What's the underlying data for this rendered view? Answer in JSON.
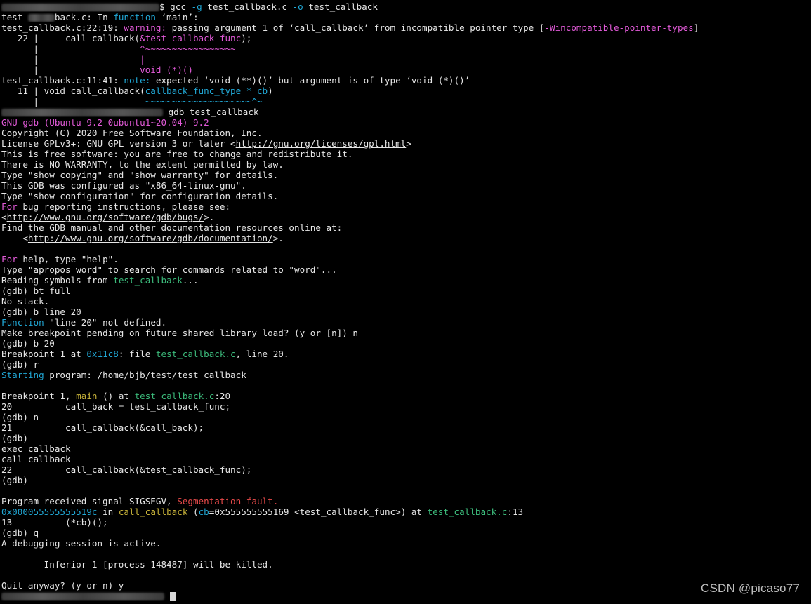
{
  "terminal": {
    "lines": [
      [
        {
          "t": "blur",
          "w": 225
        },
        {
          "t": "$ gcc "
        },
        {
          "t": "-g",
          "c": "cyan"
        },
        {
          "t": " test_callback.c "
        },
        {
          "t": "-o",
          "c": "cyan"
        },
        {
          "t": " test_callback"
        }
      ],
      [
        {
          "t": "test_"
        },
        {
          "t": "blur",
          "w": 38
        },
        {
          "t": "back.c: In "
        },
        {
          "t": "function",
          "c": "cyan"
        },
        {
          "t": " ‘main’:"
        }
      ],
      [
        {
          "t": "test_callback.c:22:19: "
        },
        {
          "t": "warning:",
          "c": "magenta"
        },
        {
          "t": " passing argument 1 of ‘call_callback’ from incompatible pointer type "
        },
        {
          "t": "[",
          "c": "white"
        },
        {
          "t": "-Wincompatible-pointer-types",
          "c": "magenta"
        },
        {
          "t": "]",
          "c": "white"
        }
      ],
      [
        {
          "t": "   22 |     call_callback("
        },
        {
          "t": "&test_callback_func",
          "c": "magenta"
        },
        {
          "t": ");"
        }
      ],
      [
        {
          "t": "      |                   "
        },
        {
          "t": "^~~~~~~~~~~~~~~~~~",
          "c": "magenta"
        }
      ],
      [
        {
          "t": "      |                   "
        },
        {
          "t": "|",
          "c": "magenta"
        }
      ],
      [
        {
          "t": "      |                   "
        },
        {
          "t": "void (*)()",
          "c": "magenta"
        }
      ],
      [
        {
          "t": "test_callback.c:11:41: "
        },
        {
          "t": "note:",
          "c": "cyan"
        },
        {
          "t": " expected ‘void (**)()’ but argument is of type ‘void (*)()’"
        }
      ],
      [
        {
          "t": "   11 | void call_callback("
        },
        {
          "t": "callback_func_type * cb",
          "c": "cyan"
        },
        {
          "t": ")"
        }
      ],
      [
        {
          "t": "      |                    "
        },
        {
          "t": "~~~~~~~~~~~~~~~~~~~~^~",
          "c": "cyan"
        }
      ],
      [
        {
          "t": "blur",
          "w": 230
        },
        {
          "t": " gdb test_callback"
        }
      ],
      [
        {
          "t": "GNU gdb (Ubuntu 9.2-0ubuntu1~20.04) 9.2",
          "c": "magenta"
        }
      ],
      [
        {
          "t": "Copyright (C) 2020 Free Software Foundation, Inc."
        }
      ],
      [
        {
          "t": "License GPLv3+: GNU GPL version 3 or later <"
        },
        {
          "t": "http://gnu.org/licenses/gpl.html",
          "u": true
        },
        {
          "t": ">"
        }
      ],
      [
        {
          "t": "This is free software: you are free to change and redistribute it."
        }
      ],
      [
        {
          "t": "There is NO WARRANTY, to the extent permitted by law."
        }
      ],
      [
        {
          "t": "Type \"show copying\" and \"show warranty\" for details."
        }
      ],
      [
        {
          "t": "This GDB was configured as \"x86_64-linux-gnu\"."
        }
      ],
      [
        {
          "t": "Type \"show configuration\" for configuration details."
        }
      ],
      [
        {
          "t": "For",
          "c": "magenta"
        },
        {
          "t": " bug reporting instructions, please see:"
        }
      ],
      [
        {
          "t": "<"
        },
        {
          "t": "http://www.gnu.org/software/gdb/bugs/",
          "u": true
        },
        {
          "t": ">."
        }
      ],
      [
        {
          "t": "Find the GDB manual and other documentation resources online at:"
        }
      ],
      [
        {
          "t": "    <"
        },
        {
          "t": "http://www.gnu.org/software/gdb/documentation/",
          "u": true
        },
        {
          "t": ">."
        }
      ],
      [
        {
          "t": ""
        }
      ],
      [
        {
          "t": "For",
          "c": "magenta"
        },
        {
          "t": " help, type \"help\"."
        }
      ],
      [
        {
          "t": "Type \"apropos word\" to search for commands related to \"word\"..."
        }
      ],
      [
        {
          "t": "Reading symbols from "
        },
        {
          "t": "test_callback",
          "c": "green"
        },
        {
          "t": "..."
        }
      ],
      [
        {
          "t": "(gdb) bt full"
        }
      ],
      [
        {
          "t": "No stack."
        }
      ],
      [
        {
          "t": "(gdb) b line 20"
        }
      ],
      [
        {
          "t": "Function",
          "c": "cyan"
        },
        {
          "t": " \"line 20\" not defined."
        }
      ],
      [
        {
          "t": "Make breakpoint pending on future shared library load? (y or [n]) n"
        }
      ],
      [
        {
          "t": "(gdb) b 20"
        }
      ],
      [
        {
          "t": "Breakpoint 1 at "
        },
        {
          "t": "0x11c8",
          "c": "cyan"
        },
        {
          "t": ": file "
        },
        {
          "t": "test_callback.c",
          "c": "green"
        },
        {
          "t": ", line 20."
        }
      ],
      [
        {
          "t": "(gdb) r"
        }
      ],
      [
        {
          "t": "Starting",
          "c": "cyan"
        },
        {
          "t": " program: /home/bjb/test/test_callback"
        }
      ],
      [
        {
          "t": ""
        }
      ],
      [
        {
          "t": "Breakpoint 1, "
        },
        {
          "t": "main",
          "c": "yellow"
        },
        {
          "t": " () at "
        },
        {
          "t": "test_callback.c",
          "c": "green"
        },
        {
          "t": ":20"
        }
      ],
      [
        {
          "t": "20          call_back = test_callback_func;"
        }
      ],
      [
        {
          "t": "(gdb) n"
        }
      ],
      [
        {
          "t": "21          call_callback(&call_back);"
        }
      ],
      [
        {
          "t": "(gdb)"
        }
      ],
      [
        {
          "t": "exec callback"
        }
      ],
      [
        {
          "t": "call callback"
        }
      ],
      [
        {
          "t": "22          call_callback(&test_callback_func);"
        }
      ],
      [
        {
          "t": "(gdb)"
        }
      ],
      [
        {
          "t": ""
        }
      ],
      [
        {
          "t": "Program received signal SIGSEGV, "
        },
        {
          "t": "Segmentation fault.",
          "c": "red"
        }
      ],
      [
        {
          "t": "0x000055555555519c",
          "c": "cyan"
        },
        {
          "t": " in "
        },
        {
          "t": "call_callback",
          "c": "yellow"
        },
        {
          "t": " ("
        },
        {
          "t": "cb",
          "c": "cyan"
        },
        {
          "t": "=0x555555555169 <test_callback_func>) at "
        },
        {
          "t": "test_callback.c",
          "c": "green"
        },
        {
          "t": ":13"
        }
      ],
      [
        {
          "t": "13          (*cb)();"
        }
      ],
      [
        {
          "t": "(gdb) q"
        }
      ],
      [
        {
          "t": "A debugging session is active."
        }
      ],
      [
        {
          "t": ""
        }
      ],
      [
        {
          "t": "        Inferior 1 [process 148487] will be killed."
        }
      ],
      [
        {
          "t": ""
        }
      ],
      [
        {
          "t": "Quit anyway? (y or n) y"
        }
      ],
      [
        {
          "t": "blur",
          "w": 232
        },
        {
          "t": " "
        },
        {
          "t": "cursor"
        }
      ]
    ]
  },
  "watermark": "CSDN @picaso77",
  "colors": {
    "background": "#000000",
    "text": "#e6e6e6",
    "magenta": "#e25ad8",
    "cyan": "#21a8d6",
    "green": "#3cbc7c",
    "yellow": "#c9b43a",
    "red": "#e84a4a"
  }
}
